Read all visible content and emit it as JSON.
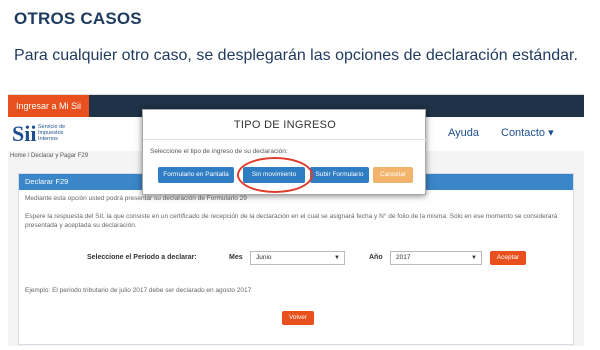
{
  "slide": {
    "title": "OTROS CASOS",
    "text": "Para cualquier otro caso, se desplegarán las opciones de declaración estándar."
  },
  "topbar": {
    "login_label": "Ingresar a Mi Sii"
  },
  "header": {
    "logo_mark": "Sii",
    "logo_text": "Servicio de\nImpuestos\nInternos",
    "nav_ayuda": "Ayuda",
    "nav_contacto": "Contacto ▾"
  },
  "breadcrumb": "Home / Declarar y Pagar F29",
  "panel": {
    "header": "Declarar F29",
    "line1": "Mediante esta opción usted podrá presentar su declaración de Formulario 29",
    "line2": "Espere la respuesta del SII, la que consiste en un certificado de recepción de la declaración en el cual se asignará fecha y N° de folio de la misma. Sólo en ese momento se considerará presentada y aceptada su declaración.",
    "select_label": "Seleccione el Periodo a declarar:",
    "mes_label": "Mes",
    "mes_value": "Junio",
    "anio_label": "Año",
    "anio_value": "2017",
    "aceptar": "Aceptar",
    "example": "Ejemplo: El periodo tributario de julio 2017 debe ser declarado en agosto 2017",
    "volver": "Volver"
  },
  "modal": {
    "title": "TIPO DE INGRESO",
    "text": "Seleccione el tipo de ingreso de su declaración:",
    "buttons": [
      "Formulario en Pantalla",
      "Sin movimiento",
      "Subir Formulario",
      "Cancelar"
    ]
  },
  "colors": {
    "accent_orange": "#e8501d",
    "primary_blue": "#2f7dc3",
    "highlight_red": "#e03a2a",
    "title_navy": "#1f3a5f"
  }
}
